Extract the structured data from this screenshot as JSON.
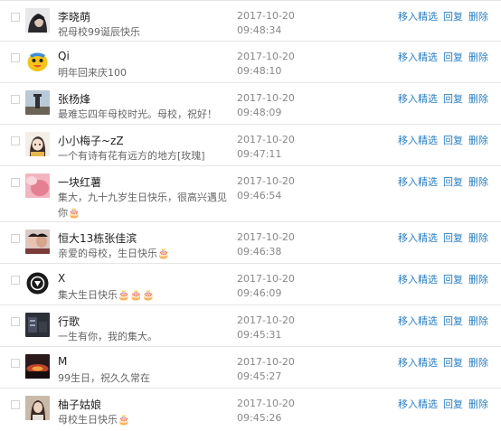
{
  "rows": [
    {
      "name": "李晓萌",
      "message": "祝母校99诞辰快乐",
      "time": "2017-10-20 09:48:34",
      "avatar": "avatar-dark-hair"
    },
    {
      "name": "Qi",
      "message": "明年回来庆100",
      "time": "2017-10-20 09:48:10",
      "avatar": "avatar-yellow-cartoon"
    },
    {
      "name": "张杨烽",
      "message": "最难忘四年母校时光。母校，祝好！",
      "time": "2017-10-20 09:48:09",
      "avatar": "avatar-tower"
    },
    {
      "name": "小小梅子~zZ",
      "message": "一个有诗有花有远方的地方[玫瑰]",
      "time": "2017-10-20 09:47:11",
      "avatar": "avatar-cartoon-girl"
    },
    {
      "name": "一块红薯",
      "message": "集大，九十九岁生日快乐，很高兴遇见你🎂",
      "time": "2017-10-20 09:46:54",
      "avatar": "avatar-pink-blur"
    },
    {
      "name": "恒大13栋张佳滨",
      "message": "亲爱的母校，生日快乐🎂",
      "time": "2017-10-20 09:46:38",
      "avatar": "avatar-couple"
    },
    {
      "name": "X",
      "message": "集大生日快乐🎂🎂🎂",
      "time": "2017-10-20 09:46:09",
      "avatar": "avatar-black-logo"
    },
    {
      "name": "行歌",
      "message": "一生有你，我的集大。",
      "time": "2017-10-20 09:45:31",
      "avatar": "avatar-dark-building"
    },
    {
      "name": "M",
      "message": "99生日，祝久久常在",
      "time": "2017-10-20 09:45:27",
      "avatar": "avatar-sunset"
    },
    {
      "name": "柚子姑娘",
      "message": "母校生日快乐🎂",
      "time": "2017-10-20 09:45:26",
      "avatar": "avatar-girl-portrait"
    }
  ],
  "actions": {
    "feature": "移入精选",
    "reply": "回复",
    "delete": "删除"
  },
  "colors": {
    "link": "#2b7fc2",
    "name": "#222222",
    "message": "#666666",
    "time": "#888888",
    "divider": "#e6e6e6"
  }
}
